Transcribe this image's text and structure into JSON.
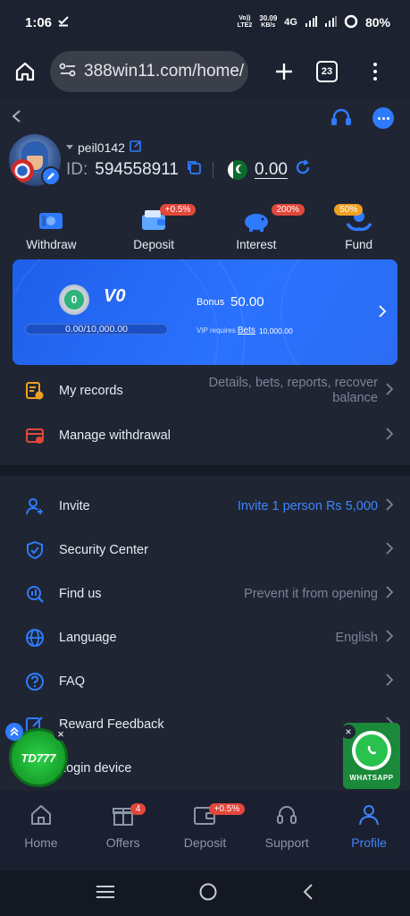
{
  "status": {
    "time": "1:06",
    "volte": "Vo))",
    "lte": "LTE2",
    "speed_value": "30.09",
    "speed_unit": "KB/s",
    "network": "4G",
    "battery": "80%"
  },
  "browser": {
    "url": "388win11.com/home/",
    "tab_count": "23"
  },
  "profile": {
    "username": "peil0142",
    "id_label": "ID:",
    "id_value": "594558911",
    "balance": "0.00"
  },
  "quick_actions": [
    {
      "label": "Withdraw",
      "badge": ""
    },
    {
      "label": "Deposit",
      "badge": "+0.5%"
    },
    {
      "label": "Interest",
      "badge": "200%"
    },
    {
      "label": "Fund",
      "badge": "50%"
    }
  ],
  "vip": {
    "medal_level": "0",
    "level": "V0",
    "progress_text": "0.00/10,000.00",
    "bonus_label": "Bonus",
    "bonus_value": "50.00",
    "requires_label": "VIP requires",
    "bets_link": "Bets",
    "bets_amount": "10,000.00"
  },
  "records_rows": [
    {
      "label": "My records",
      "right": "Details, bets, reports, recover balance"
    },
    {
      "label": "Manage withdrawal",
      "right": ""
    }
  ],
  "menu_rows": [
    {
      "label": "Invite",
      "right": "Invite 1 person Rs 5,000"
    },
    {
      "label": "Security Center",
      "right": ""
    },
    {
      "label": "Find us",
      "right": "Prevent it from opening"
    },
    {
      "label": "Language",
      "right": "English"
    },
    {
      "label": "FAQ",
      "right": ""
    },
    {
      "label": "Reward Feedback",
      "right": ""
    },
    {
      "label": "Login device",
      "right": ""
    }
  ],
  "widgets": {
    "td_label": "TD777",
    "whatsapp_label": "WHATSAPP"
  },
  "bottom_nav": [
    {
      "label": "Home",
      "badge": ""
    },
    {
      "label": "Offers",
      "badge": "4"
    },
    {
      "label": "Deposit",
      "badge": "+0.5%"
    },
    {
      "label": "Support",
      "badge": ""
    },
    {
      "label": "Profile",
      "badge": ""
    }
  ],
  "colors": {
    "accent": "#3d84ff",
    "vip_card": "#2a72ff",
    "badge_red": "#e2473b",
    "badge_orange": "#f0a020",
    "whatsapp": "#28c24d"
  }
}
